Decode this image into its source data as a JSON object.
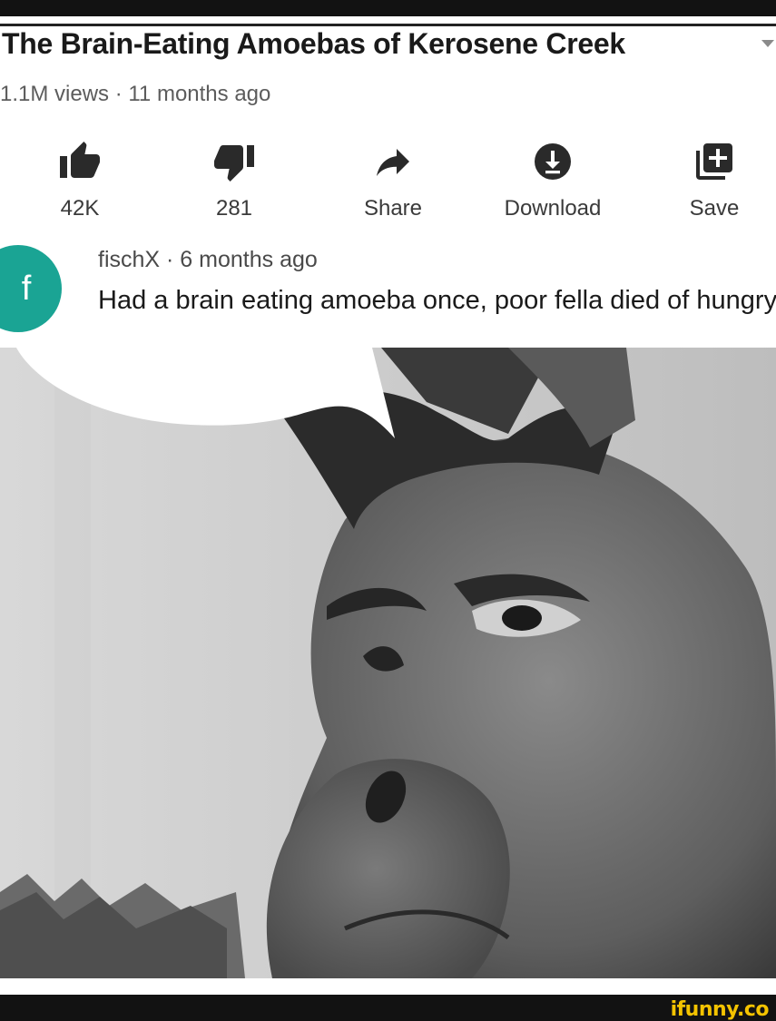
{
  "video": {
    "title": "The Brain-Eating Amoebas of Kerosene Creek",
    "meta": "1.1M views · 11 months ago"
  },
  "actions": [
    {
      "icon": "thumbs-up-icon",
      "label": "42K"
    },
    {
      "icon": "thumbs-down-icon",
      "label": "281"
    },
    {
      "icon": "share-icon",
      "label": "Share"
    },
    {
      "icon": "download-icon",
      "label": "Download"
    },
    {
      "icon": "save-to-playlist-icon",
      "label": "Save"
    }
  ],
  "comment": {
    "avatar_letter": "f",
    "avatar_color": "#1aa494",
    "meta": "fischX · 6 months ago",
    "text": "Had a brain eating amoeba once, poor fella died of hungry"
  },
  "watermark": "ifunny.co",
  "colors": {
    "watermark": "#f4c300",
    "background": "#121212"
  }
}
